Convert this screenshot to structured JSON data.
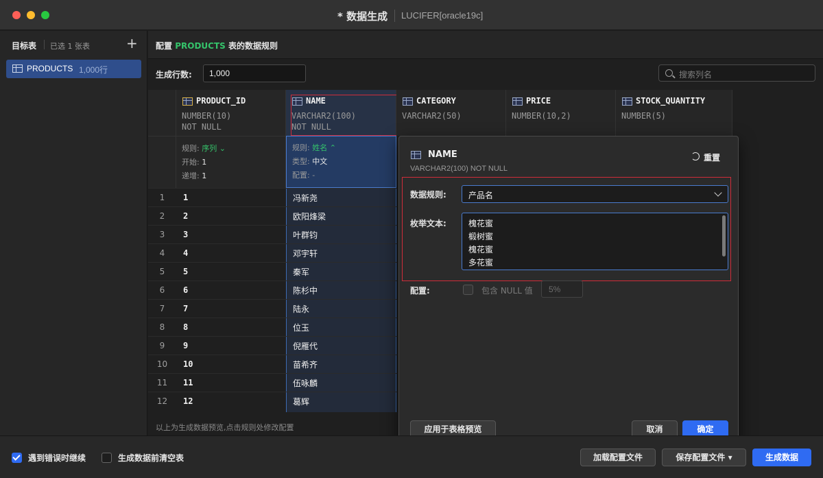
{
  "window": {
    "title": "* 数据生成",
    "subtitle": "LUCIFER[oracle19c]"
  },
  "sidebar": {
    "header": "目标表",
    "selected_count": "已选 1 张表",
    "add_label": "+",
    "tables": [
      {
        "name": "PRODUCTS",
        "rows": "1,000行"
      }
    ]
  },
  "config": {
    "title_prefix": "配置",
    "table": "PRODUCTS",
    "title_suffix": "表的数据规则",
    "rows_label": "生成行数:",
    "rows_value": "1,000",
    "search_placeholder": "搜索列名"
  },
  "columns": [
    {
      "name": "PRODUCT_ID",
      "type": "NUMBER(10)",
      "constraint": "NOT NULL",
      "pk": true,
      "rule": {
        "label": "规则:",
        "value": "序列",
        "start_label": "开始:",
        "start": "1",
        "step_label": "递增:",
        "step": "1"
      }
    },
    {
      "name": "NAME",
      "type": "VARCHAR2(100)",
      "constraint": "NOT NULL",
      "pk": false,
      "rule": {
        "label": "规则:",
        "value": "姓名",
        "type_label": "类型:",
        "type": "中文",
        "cfg_label": "配置:",
        "cfg": "-"
      }
    },
    {
      "name": "CATEGORY",
      "type": "VARCHAR2(50)",
      "constraint": "",
      "pk": false
    },
    {
      "name": "PRICE",
      "type": "NUMBER(10,2)",
      "constraint": "",
      "pk": false
    },
    {
      "name": "STOCK_QUANTITY",
      "type": "NUMBER(5)",
      "constraint": "",
      "pk": false
    }
  ],
  "rows": [
    {
      "n": "1",
      "id": "1",
      "name": "冯新尧"
    },
    {
      "n": "2",
      "id": "2",
      "name": "欧阳烽梁"
    },
    {
      "n": "3",
      "id": "3",
      "name": "叶群钧"
    },
    {
      "n": "4",
      "id": "4",
      "name": "邓宇轩"
    },
    {
      "n": "5",
      "id": "5",
      "name": "秦军"
    },
    {
      "n": "6",
      "id": "6",
      "name": "陈杉中"
    },
    {
      "n": "7",
      "id": "7",
      "name": "陆永"
    },
    {
      "n": "8",
      "id": "8",
      "name": "位玉"
    },
    {
      "n": "9",
      "id": "9",
      "name": "倪雁代"
    },
    {
      "n": "10",
      "id": "10",
      "name": "苗希齐"
    },
    {
      "n": "11",
      "id": "11",
      "name": "伍咏麟"
    },
    {
      "n": "12",
      "id": "12",
      "name": "葛辉"
    }
  ],
  "preview_hint": "以上为生成数据预览,点击规则处修改配置",
  "popover": {
    "column": "NAME",
    "type": "VARCHAR2(100) NOT NULL",
    "reset_label": "重置",
    "rule_label": "数据规则:",
    "rule_value": "产品名",
    "enum_label": "枚举文本:",
    "enum_lines": [
      "槐花蜜",
      "椴树蜜",
      "槐花蜜",
      "多花蜜"
    ],
    "config_label": "配置:",
    "include_null_label": "包含 NULL 值",
    "null_pct": "5%",
    "apply_label": "应用于表格预览",
    "cancel_label": "取消",
    "ok_label": "确定"
  },
  "bottom": {
    "continue_on_error": "遇到错误时继续",
    "continue_checked": true,
    "clear_before": "生成数据前清空表",
    "clear_checked": false,
    "load_config": "加载配置文件",
    "save_config": "保存配置文件",
    "generate": "生成数据"
  },
  "colors": {
    "accent": "#2f6bf2",
    "table_name": "#35c46b",
    "highlight": "#d12c3a"
  }
}
